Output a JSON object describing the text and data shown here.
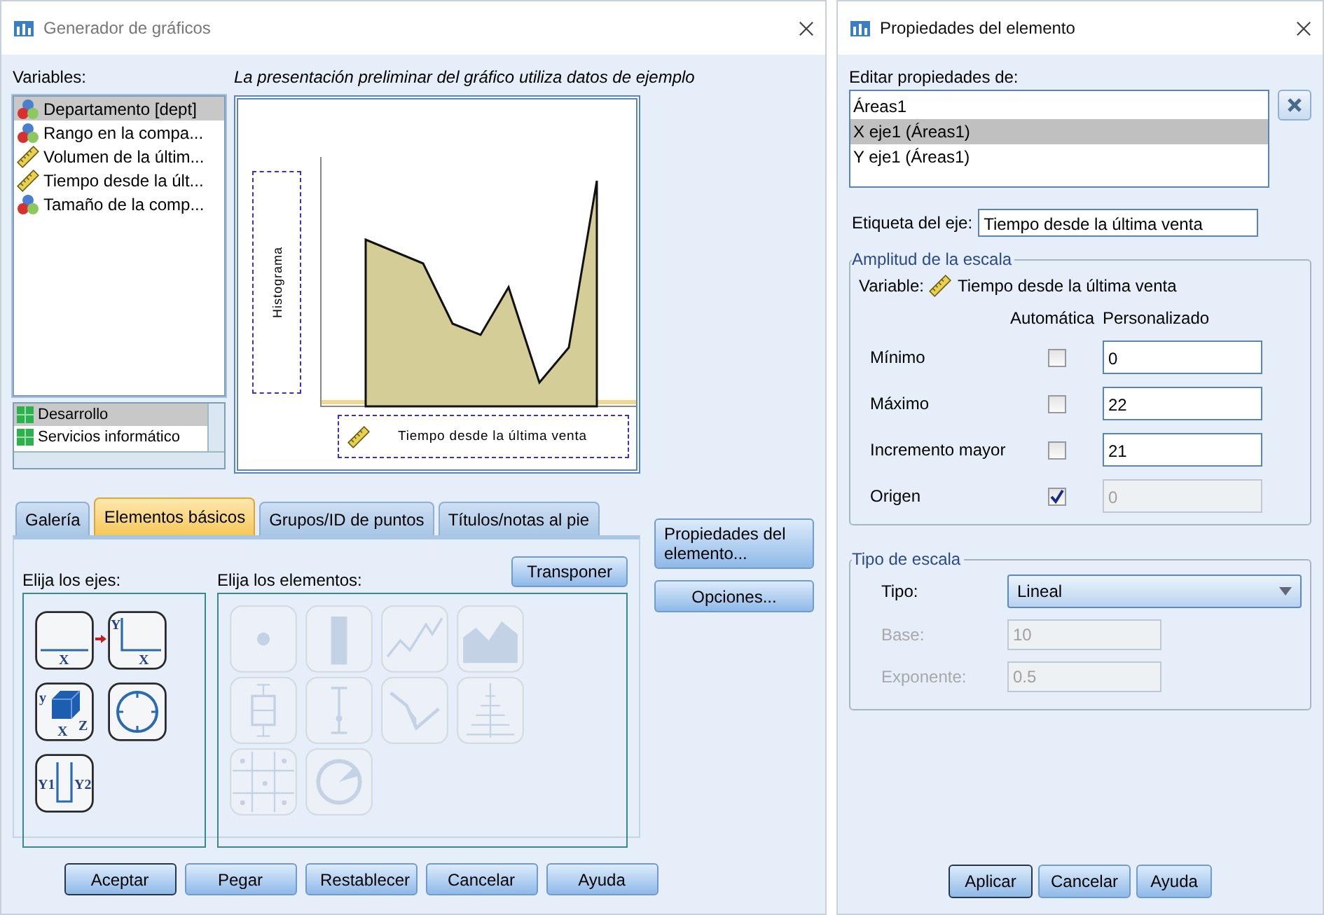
{
  "left_window": {
    "title": "Generador de gráficos",
    "variables_label": "Variables:",
    "variables": [
      {
        "name": "Departamento [dept]",
        "kind": "nominal",
        "selected": true
      },
      {
        "name": "Rango en la compa...",
        "kind": "nominal",
        "selected": false
      },
      {
        "name": "Volumen de la últim...",
        "kind": "scale",
        "selected": false
      },
      {
        "name": "Tiempo desde la últ...",
        "kind": "scale",
        "selected": false
      },
      {
        "name": "Tamaño de la comp...",
        "kind": "nominal",
        "selected": false
      }
    ],
    "categories": [
      {
        "name": "Desarrollo",
        "selected": true
      },
      {
        "name": "Servicios informático",
        "selected": false
      }
    ],
    "preview_caption": "La presentación preliminar del gráfico utiliza datos de ejemplo",
    "y_drop_zone": "Histograma",
    "x_drop_zone": "Tiempo desde la última venta",
    "tabs": [
      {
        "label": "Galería",
        "selected": false
      },
      {
        "label": "Elementos básicos",
        "selected": true
      },
      {
        "label": "Grupos/ID de puntos",
        "selected": false
      },
      {
        "label": "Títulos/notas al pie",
        "selected": false
      }
    ],
    "axes_label": "Elija los ejes:",
    "elements_label": "Elija los elementos:",
    "transpose_button": "Transponer",
    "axes": [
      {
        "kind": "x",
        "labels": [
          "X"
        ]
      },
      {
        "kind": "xy",
        "labels": [
          "Y",
          "X"
        ]
      },
      {
        "kind": "xyz",
        "labels": [
          "y",
          "X",
          "Z"
        ]
      },
      {
        "kind": "polar"
      },
      {
        "kind": "dual",
        "labels": [
          "Y1",
          "Y2"
        ]
      }
    ],
    "elements": [
      {
        "kind": "point",
        "disabled": true
      },
      {
        "kind": "bar",
        "disabled": true
      },
      {
        "kind": "line",
        "disabled": true
      },
      {
        "kind": "area",
        "disabled": true
      },
      {
        "kind": "box",
        "disabled": true
      },
      {
        "kind": "error",
        "disabled": true
      },
      {
        "kind": "difference",
        "disabled": true
      },
      {
        "kind": "pyramid",
        "disabled": true
      },
      {
        "kind": "matrix",
        "disabled": true
      },
      {
        "kind": "pie",
        "disabled": true
      }
    ],
    "side_buttons": [
      "Propiedades del elemento...",
      "Opciones..."
    ],
    "buttons": [
      {
        "label": "Aceptar",
        "default": true
      },
      {
        "label": "Pegar",
        "default": false
      },
      {
        "label": "Restablecer",
        "default": false
      },
      {
        "label": "Cancelar",
        "default": false
      },
      {
        "label": "Ayuda",
        "default": false
      }
    ]
  },
  "right_window": {
    "title": "Propiedades del elemento",
    "edit_label": "Editar propiedades de:",
    "edit_items": [
      {
        "label": "Áreas1",
        "selected": false
      },
      {
        "label": "X eje1 (Áreas1)",
        "selected": true
      },
      {
        "label": "Y eje1 (Áreas1)",
        "selected": false
      }
    ],
    "axis_label_label": "Etiqueta del eje:",
    "axis_label_value": "Tiempo desde la última venta",
    "scale_range": {
      "title": "Amplitud de la escala",
      "variable_label": "Variable:",
      "variable_name": "Tiempo desde la última venta",
      "auto_header": "Automática",
      "custom_header": "Personalizado",
      "rows": [
        {
          "label": "Mínimo",
          "checked": false,
          "value": "0",
          "disabled": false
        },
        {
          "label": "Máximo",
          "checked": false,
          "value": "22",
          "disabled": false
        },
        {
          "label": "Incremento mayor",
          "checked": false,
          "value": "21",
          "disabled": false
        },
        {
          "label": "Origen",
          "checked": true,
          "value": "0",
          "disabled": true
        }
      ]
    },
    "scale_type": {
      "title": "Tipo de escala",
      "type_label": "Tipo:",
      "type_value": "Lineal",
      "fields": [
        {
          "label": "Base:",
          "value": "10",
          "disabled": true
        },
        {
          "label": "Exponente:",
          "value": "0.5",
          "disabled": true
        }
      ]
    },
    "buttons": [
      {
        "label": "Aplicar",
        "default": true
      },
      {
        "label": "Cancelar",
        "default": false
      },
      {
        "label": "Ayuda",
        "default": false
      }
    ]
  }
}
